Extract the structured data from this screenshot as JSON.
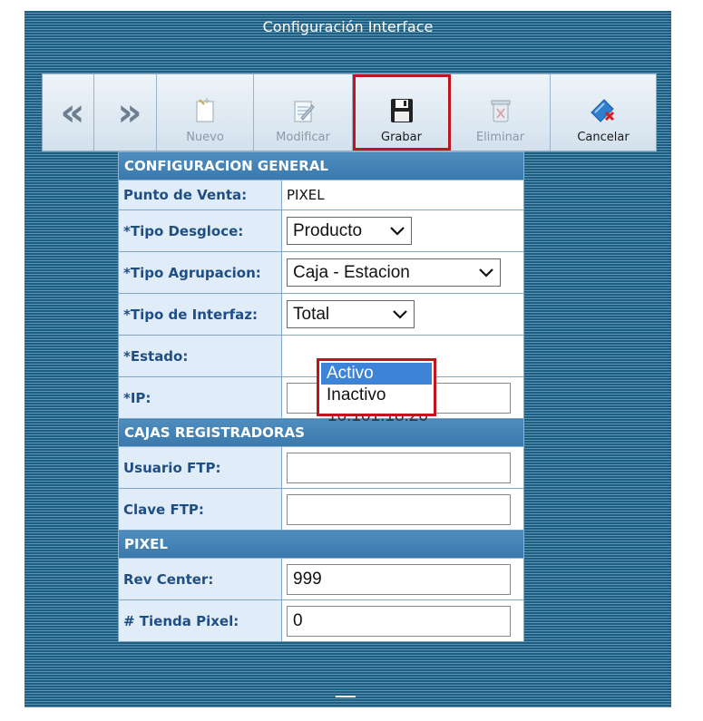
{
  "window": {
    "title": "Configuración Interface"
  },
  "toolbar": {
    "prev": "«",
    "next": "»",
    "buttons": [
      {
        "label": "Nuevo",
        "icon": "new-document-icon",
        "enabled": false
      },
      {
        "label": "Modificar",
        "icon": "edit-document-icon",
        "enabled": false
      },
      {
        "label": "Grabar",
        "icon": "floppy-disk-icon",
        "enabled": true,
        "highlighted": true
      },
      {
        "label": "Eliminar",
        "icon": "trash-icon",
        "enabled": false
      },
      {
        "label": "Cancelar",
        "icon": "cancel-icon",
        "enabled": true
      }
    ]
  },
  "form": {
    "section_general": "CONFIGURACION GENERAL",
    "punto_venta": {
      "label": "Punto de Venta:",
      "value": "PIXEL"
    },
    "tipo_desgloce": {
      "label": "*Tipo Desgloce:",
      "value": "Producto"
    },
    "tipo_agrupacion": {
      "label": "*Tipo Agrupacion:",
      "value": "Caja - Estacion"
    },
    "tipo_interfaz": {
      "label": "*Tipo de Interfaz:",
      "value": "Total"
    },
    "estado": {
      "label": "*Estado:",
      "options": [
        "Activo",
        "Inactivo"
      ],
      "highlighted": "Activo"
    },
    "ip": {
      "label": "*IP:",
      "value": "10.101.18.20"
    },
    "section_cajas": "CAJAS REGISTRADORAS",
    "usuario_ftp": {
      "label": "Usuario FTP:",
      "value": ""
    },
    "clave_ftp": {
      "label": "Clave FTP:",
      "value": ""
    },
    "section_pixel": "PIXEL",
    "rev_center": {
      "label": "Rev Center:",
      "value": "999"
    },
    "tienda_pixel": {
      "label": "# Tienda Pixel:",
      "value": "0"
    }
  },
  "colors": {
    "panel": "#1d5f82",
    "header": "#4282b5",
    "label_bg": "#e0edf8",
    "highlight_border": "#c0151d",
    "option_highlight": "#3d83d8"
  }
}
